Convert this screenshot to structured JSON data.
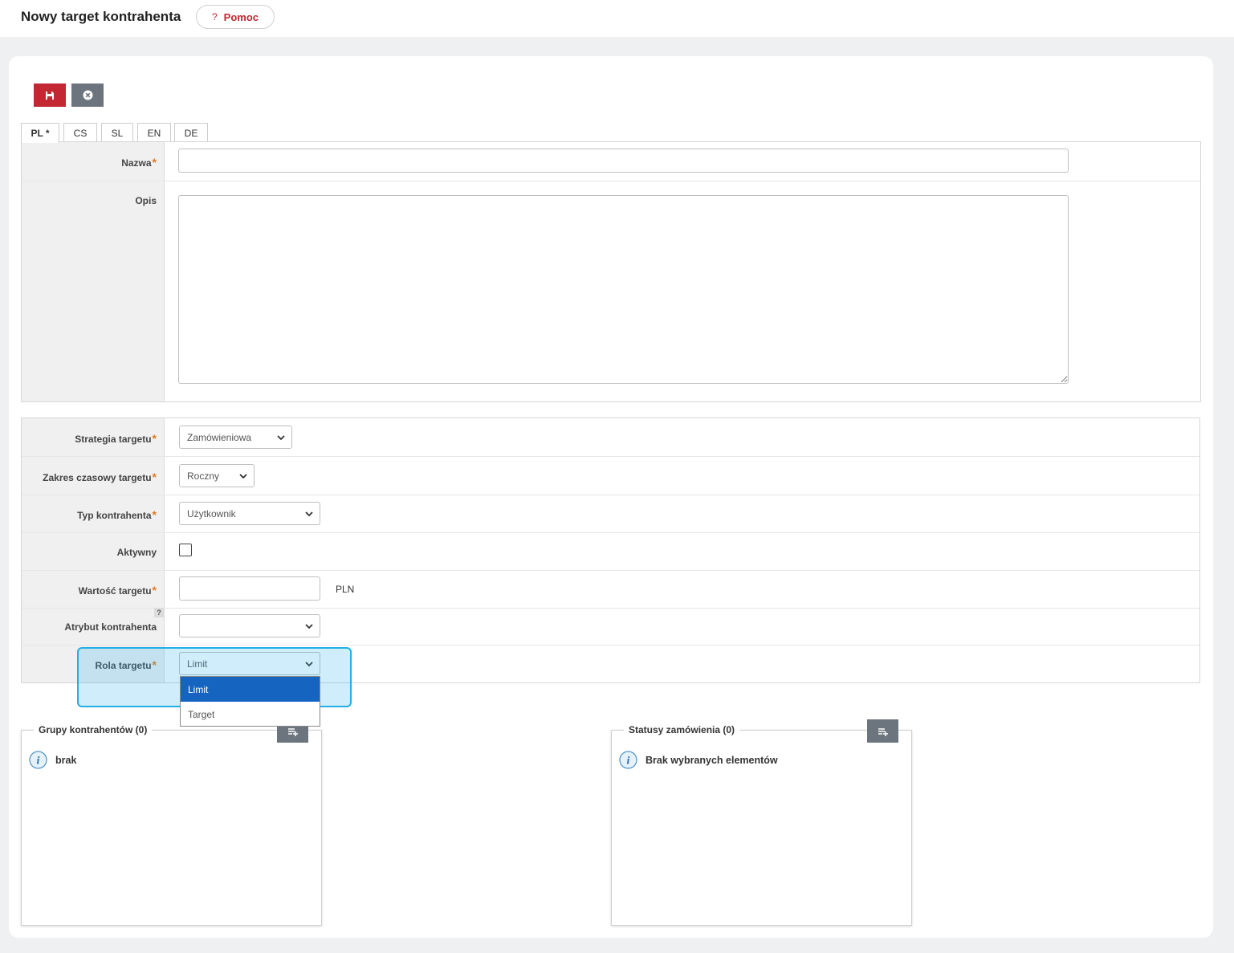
{
  "header": {
    "title": "Nowy target kontrahenta",
    "help_icon": "?",
    "help_label": "Pomoc"
  },
  "toolbar": {
    "save_icon": "save-icon",
    "cancel_icon": "close-circle-icon"
  },
  "tabs": [
    {
      "label": "PL *",
      "active": true
    },
    {
      "label": "CS",
      "active": false
    },
    {
      "label": "SL",
      "active": false
    },
    {
      "label": "EN",
      "active": false
    },
    {
      "label": "DE",
      "active": false
    }
  ],
  "form_lang": {
    "name_label": "Nazwa",
    "name_required": "*",
    "name_value": "",
    "desc_label": "Opis",
    "desc_value": ""
  },
  "form_main": {
    "strategy": {
      "label": "Strategia targetu",
      "required": "*",
      "value": "Zamówieniowa"
    },
    "period": {
      "label": "Zakres czasowy targetu",
      "required": "*",
      "value": "Roczny"
    },
    "contractor_type": {
      "label": "Typ kontrahenta",
      "required": "*",
      "value": "Użytkownik"
    },
    "active": {
      "label": "Aktywny",
      "checked": false
    },
    "value": {
      "label": "Wartość targetu",
      "required": "*",
      "value": "",
      "unit": "PLN"
    },
    "attribute": {
      "label": "Atrybut kontrahenta",
      "help": "?",
      "value": ""
    },
    "role": {
      "label": "Rola targetu",
      "required": "*",
      "value": "Limit"
    }
  },
  "role_dropdown": {
    "options": [
      "Limit",
      "Target"
    ],
    "selected": "Limit"
  },
  "groups_box": {
    "legend": "Grupy kontrahentów (0)",
    "info_icon": "i",
    "info_text": "brak"
  },
  "statuses_box": {
    "legend": "Statusy zamówienia (0)",
    "info_icon": "i",
    "info_text": "Brak wybranych elementów"
  },
  "colors": {
    "brand_red": "#c22732",
    "secondary": "#6c757d",
    "required": "#e07a20",
    "dropdown_selected": "#1565c0",
    "highlight": "#23aee6"
  }
}
